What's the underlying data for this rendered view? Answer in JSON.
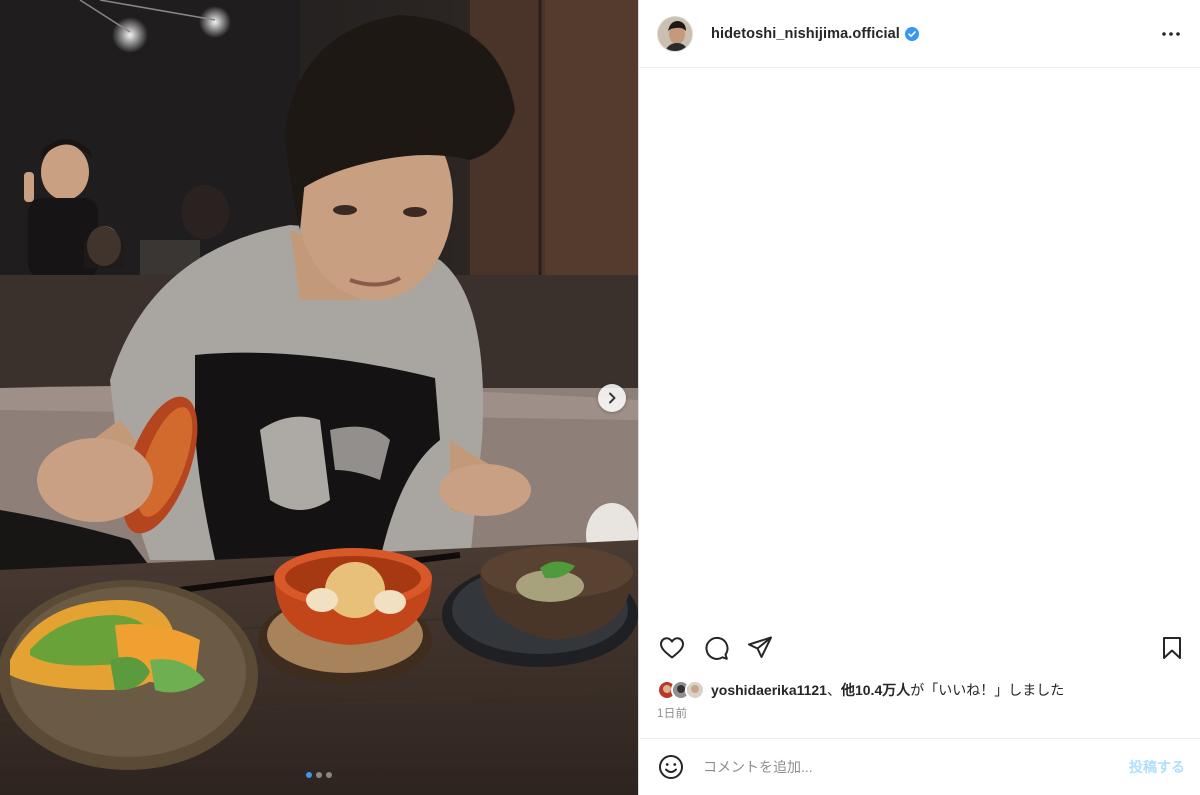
{
  "post": {
    "username": "hidetoshi_nishijima.official",
    "verified": true,
    "verified_icon": "verified-badge-icon",
    "more_icon": "more-horizontal-icon"
  },
  "carousel": {
    "total_slides": 3,
    "current_slide": 1,
    "next_icon": "chevron-right-icon"
  },
  "actions": {
    "like_icon": "heart-icon",
    "comment_icon": "comment-icon",
    "share_icon": "paper-plane-icon",
    "save_icon": "bookmark-icon"
  },
  "likes": {
    "first_liker": "yoshidaerika1121",
    "separator": "、",
    "others_count": "他10.4万人",
    "suffix": "が「いいね！」しました"
  },
  "timestamp": "1日前",
  "comment": {
    "emoji_icon": "smiley-icon",
    "placeholder": "コメントを追加...",
    "post_label": "投稿する"
  },
  "colors": {
    "accent": "#0095f6",
    "verified_blue": "#3897f0",
    "post_button_disabled": "#b2dffc",
    "muted_text": "#8e8e8e",
    "divider": "#efefef"
  }
}
